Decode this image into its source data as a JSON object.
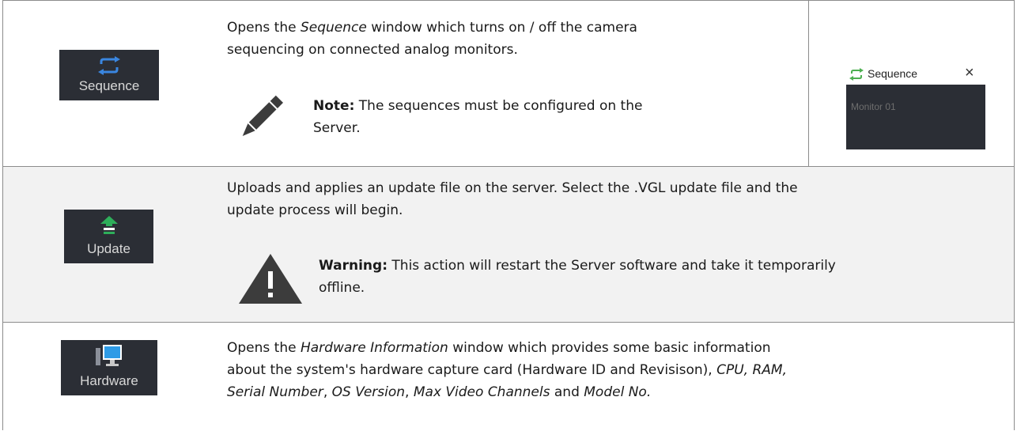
{
  "rows": [
    {
      "button": {
        "label": "Sequence",
        "icon": "sync-arrows-icon",
        "icon_color": "#3a86e0"
      },
      "desc": {
        "l1_pre": "Opens the ",
        "l1_em": "Sequence",
        "l1_post": " window which turns on / off the camera",
        "l2": "sequencing on connected analog monitors."
      },
      "note": {
        "label": "Note:",
        "l1": " The sequences must be configured on the",
        "l2": "Server.",
        "icon": "pencil-icon"
      },
      "preview": {
        "title": "Sequence",
        "close": "×",
        "monitor": "Monitor 01",
        "icon": "sync-arrows-icon",
        "icon_color": "#4caf50"
      }
    },
    {
      "button": {
        "label": "Update",
        "icon": "upload-icon",
        "icon_color": "#2eae5a"
      },
      "desc": {
        "l1": "Uploads and applies an update file on the server.  Select the .VGL update file and the",
        "l2": "update process will begin."
      },
      "warning": {
        "label": "Warning:",
        "l1": " This action will restart the Server software and take it temporarily",
        "l2": "offline.",
        "icon": "warning-triangle-icon"
      }
    },
    {
      "button": {
        "label": "Hardware",
        "icon": "computer-monitor-icon",
        "icon_color": "#2e9be6"
      },
      "desc": {
        "l1_pre": "Opens the ",
        "l1_em": "Hardware Information",
        "l1_post": " window which provides some basic information",
        "l2_pre": "about the system's hardware capture card (Hardware ID and Revisison), ",
        "l2_em": "CPU, RAM,",
        "l3_em1": "Serial Number",
        "l3_t1": ", ",
        "l3_em2": "OS Version",
        "l3_t2": ", ",
        "l3_em3": "Max Video Channels",
        "l3_t3": " and ",
        "l3_em4": "Model No."
      }
    }
  ],
  "colors": {
    "button_bg": "#2b2e35",
    "row_alt_bg": "#f2f2f2",
    "border": "#8c8c8c"
  }
}
